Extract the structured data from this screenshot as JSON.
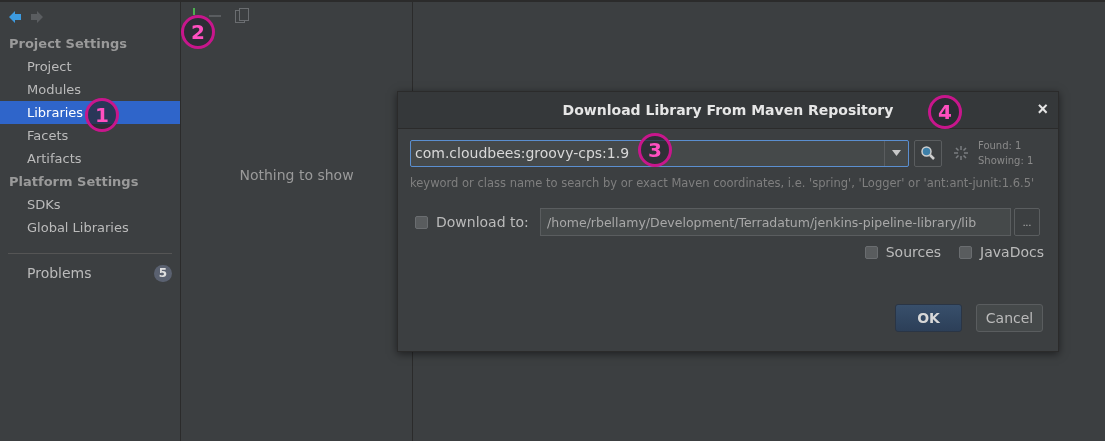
{
  "sidebar": {
    "sections": [
      {
        "title": "Project Settings",
        "items": [
          {
            "label": "Project",
            "selected": false
          },
          {
            "label": "Modules",
            "selected": false
          },
          {
            "label": "Libraries",
            "selected": true
          },
          {
            "label": "Facets",
            "selected": false
          },
          {
            "label": "Artifacts",
            "selected": false
          }
        ]
      },
      {
        "title": "Platform Settings",
        "items": [
          {
            "label": "SDKs",
            "selected": false
          },
          {
            "label": "Global Libraries",
            "selected": false
          }
        ]
      }
    ],
    "problems": {
      "label": "Problems",
      "count": "5"
    }
  },
  "library_list": {
    "empty_text": "Nothing to show"
  },
  "dialog": {
    "title": "Download Library From Maven Repository",
    "close": "×",
    "search": {
      "value": "com.cloudbees:groovy-cps:1.9"
    },
    "found": "Found: 1",
    "showing": "Showing: 1",
    "hint": "keyword or class name to search by or exact Maven coordinates, i.e. 'spring', 'Logger' or 'ant:ant-junit:1.6.5'",
    "download_to": {
      "label": "Download to:",
      "checked": false,
      "path": "/home/rbellamy/Development/Terradatum/jenkins-pipeline-library/lib",
      "browse": "..."
    },
    "options": [
      {
        "label": "Sources",
        "checked": false
      },
      {
        "label": "JavaDocs",
        "checked": false
      }
    ],
    "buttons": [
      {
        "label": "OK",
        "kind": "primary"
      },
      {
        "label": "Cancel",
        "kind": "secondary"
      }
    ]
  },
  "annotations": [
    {
      "label": "1"
    },
    {
      "label": "2"
    },
    {
      "label": "3"
    },
    {
      "label": "4"
    }
  ]
}
